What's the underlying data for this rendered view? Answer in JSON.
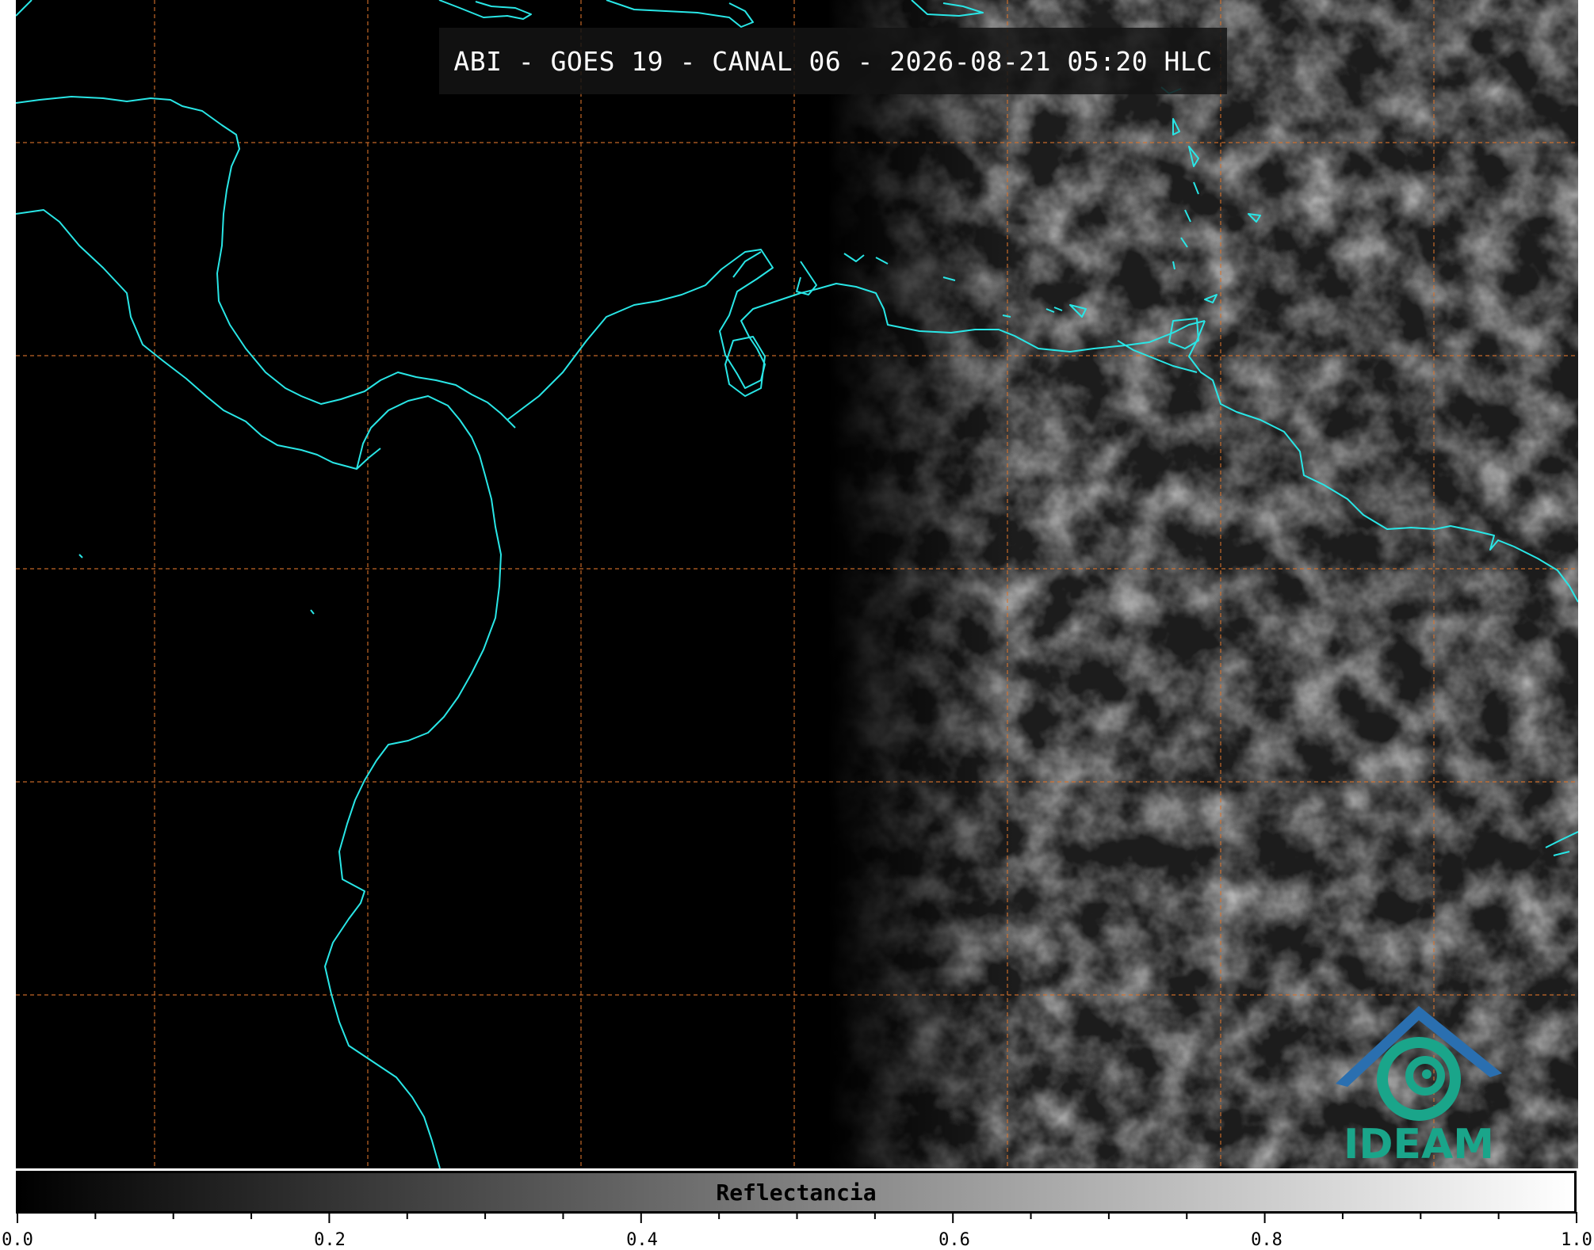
{
  "title": "ABI - GOES 19 - CANAL 06 - 2026-08-21 05:20 HLC",
  "colorbar": {
    "label": "Reflectancia",
    "min": 0.0,
    "max": 1.0,
    "tick_labels": [
      "0.0",
      "0.2",
      "0.4",
      "0.6",
      "0.8",
      "1.0"
    ],
    "colormap": "grayscale (black to white)"
  },
  "logo": {
    "text": "IDEAM"
  },
  "colors": {
    "coastline": "#29e6e6",
    "gridline": "#d9722b",
    "background": "#000000",
    "logo_teal": "#1aa58a",
    "logo_blue": "#2a6fb0"
  },
  "map": {
    "gridlines": "dashed lat/lon graticule",
    "features": [
      "coastlines",
      "cloud field (reflectance) over eastern half"
    ]
  }
}
